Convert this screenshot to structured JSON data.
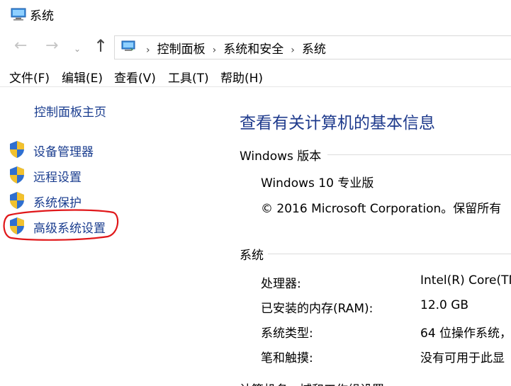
{
  "window": {
    "title": "系统"
  },
  "address": {
    "crumbs": [
      "控制面板",
      "系统和安全",
      "系统"
    ]
  },
  "nav_icons": {
    "back": "back-arrow-icon",
    "forward": "forward-arrow-icon",
    "recent": "chevron-down-icon",
    "up": "up-arrow-icon"
  },
  "menu": [
    "文件(F)",
    "编辑(E)",
    "查看(V)",
    "工具(T)",
    "帮助(H)"
  ],
  "sidebar": {
    "home": "控制面板主页",
    "links": [
      "设备管理器",
      "远程设置",
      "系统保护",
      "高级系统设置"
    ],
    "highlighted": "高级系统设置"
  },
  "main": {
    "title": "查看有关计算机的基本信息",
    "windows_section": "Windows 版本",
    "edition": "Windows 10 专业版",
    "copyright": "© 2016 Microsoft Corporation。保留所有",
    "system_section": "系统",
    "rows": [
      {
        "label": "处理器:",
        "value": "Intel(R) Core(TM"
      },
      {
        "label": "已安装的内存(RAM):",
        "value": "12.0 GB"
      },
      {
        "label": "系统类型:",
        "value": "64 位操作系统，"
      },
      {
        "label": "笔和触摸:",
        "value": "没有可用于此显"
      }
    ],
    "next_section_partial": "计算机名、域和工作组设置"
  },
  "colors": {
    "link": "#1a3d8f",
    "title": "#1e3a8c",
    "highlight_ring": "#e0171a",
    "shield_blue": "#2f6fd0",
    "shield_yellow": "#f2c12e"
  }
}
